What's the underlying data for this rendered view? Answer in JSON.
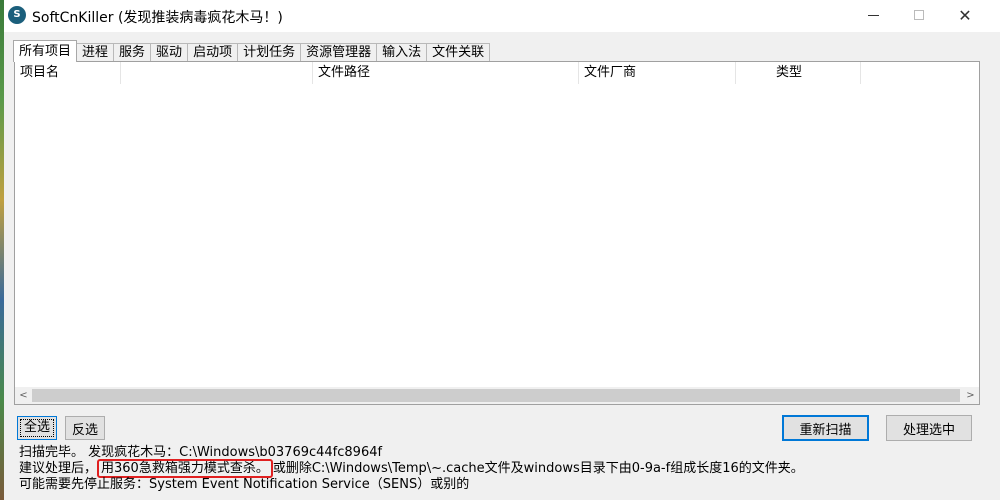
{
  "window": {
    "title": "SoftCnKiller (发现推装病毒疯花木马！)",
    "app_icon_glyph": "S",
    "minimize_glyph": "—",
    "maximize_glyph": "□",
    "close_glyph": "✕"
  },
  "tabs": [
    {
      "label": "所有项目",
      "active": true
    },
    {
      "label": "进程"
    },
    {
      "label": "服务"
    },
    {
      "label": "驱动"
    },
    {
      "label": "启动项"
    },
    {
      "label": "计划任务"
    },
    {
      "label": "资源管理器"
    },
    {
      "label": "输入法"
    },
    {
      "label": "文件关联"
    }
  ],
  "list": {
    "columns": [
      "项目名",
      "",
      "文件路径",
      "文件厂商",
      "类型",
      ""
    ],
    "rows": [],
    "scroll_left_glyph": "<",
    "scroll_right_glyph": ">"
  },
  "buttons": {
    "select_all": "全选",
    "invert": "反选",
    "rescan": "重新扫描",
    "process": "处理选中"
  },
  "status": {
    "line1": "扫描完毕。 发现疯花木马：C:\\Windows\\b03769c44fc8964f",
    "line2_prefix": "建议处理后，",
    "line2_highlight": "用360急救箱强力模式查杀。",
    "line2_suffix": "或删除C:\\Windows\\Temp\\~.cache文件及windows目录下由0-9a-f组成长度16的文件夹。",
    "line3": "可能需要先停止服务：System Event Notification Service（SENS）或别的"
  },
  "colors": {
    "accent": "#0078d7",
    "highlight": "#e02020",
    "app_icon": "#1b5f7c"
  }
}
